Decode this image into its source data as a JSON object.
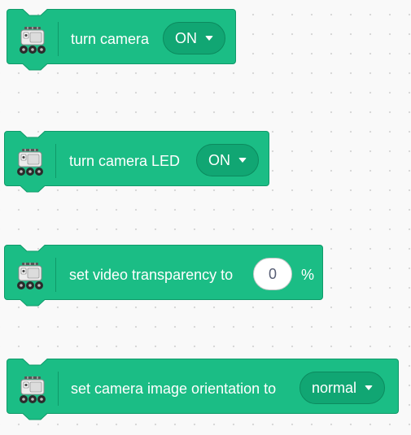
{
  "colors": {
    "block_fill": "#1bbd85",
    "block_stroke": "#0f9a69",
    "dropdown_fill": "#11a673",
    "workspace": "#f9f9f9"
  },
  "icon": "rover-robot-icon",
  "blocks": [
    {
      "label": "turn camera",
      "dropdown": "ON"
    },
    {
      "label": "turn camera LED",
      "dropdown": "ON"
    },
    {
      "label": "set video transparency to",
      "value": "0",
      "suffix": "%"
    },
    {
      "label": "set camera image orientation to",
      "dropdown": "normal"
    }
  ]
}
